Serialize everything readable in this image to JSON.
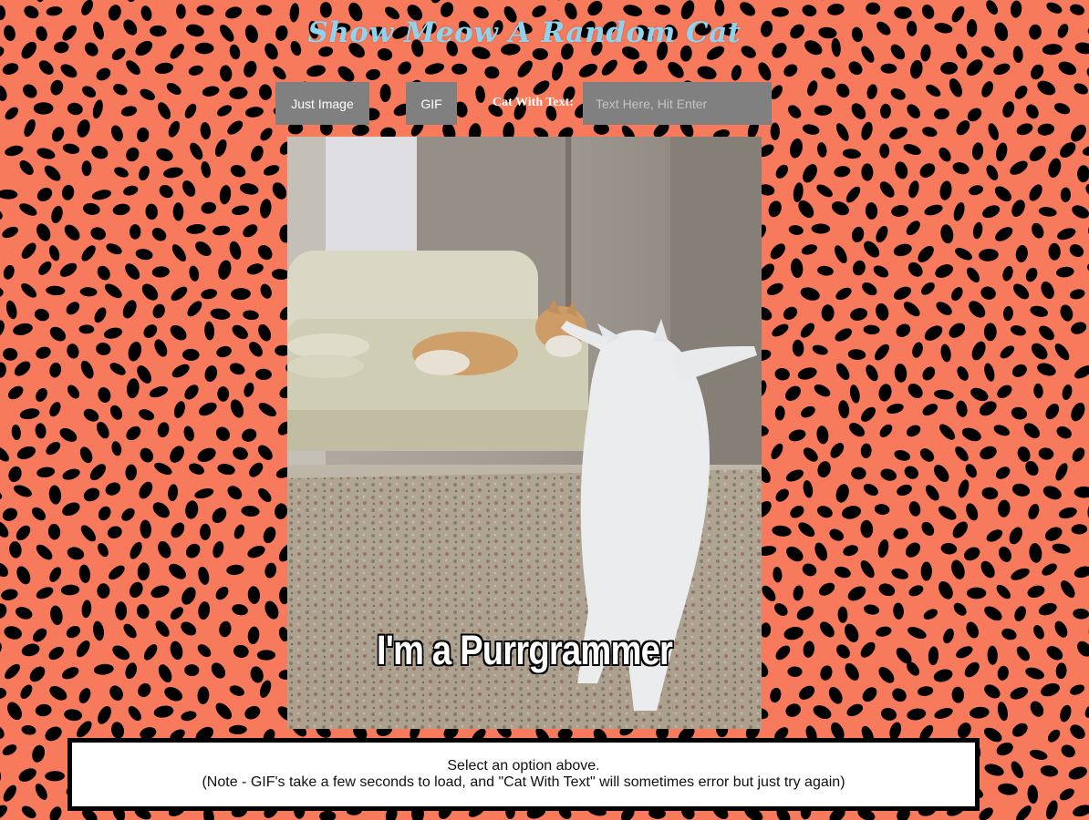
{
  "title": "Show Meow A Random Cat",
  "controls": {
    "just_image_label": "Just Image",
    "gif_label": "GIF",
    "cat_with_text_label": "Cat With Text:",
    "text_input_placeholder": "Text Here, Hit Enter",
    "text_input_value": ""
  },
  "cat_image": {
    "caption": "I'm a Purrgrammer"
  },
  "status": {
    "line1": "Select an option above.",
    "line2": "(Note - GIF's take a few seconds to load, and \"Cat With Text\" will sometimes error but just try again)"
  },
  "colors": {
    "background": "#f87a5c",
    "spots": "#000000",
    "title": "#8fd3ee",
    "button_bg": "#808080",
    "button_text": "#ffffff"
  }
}
